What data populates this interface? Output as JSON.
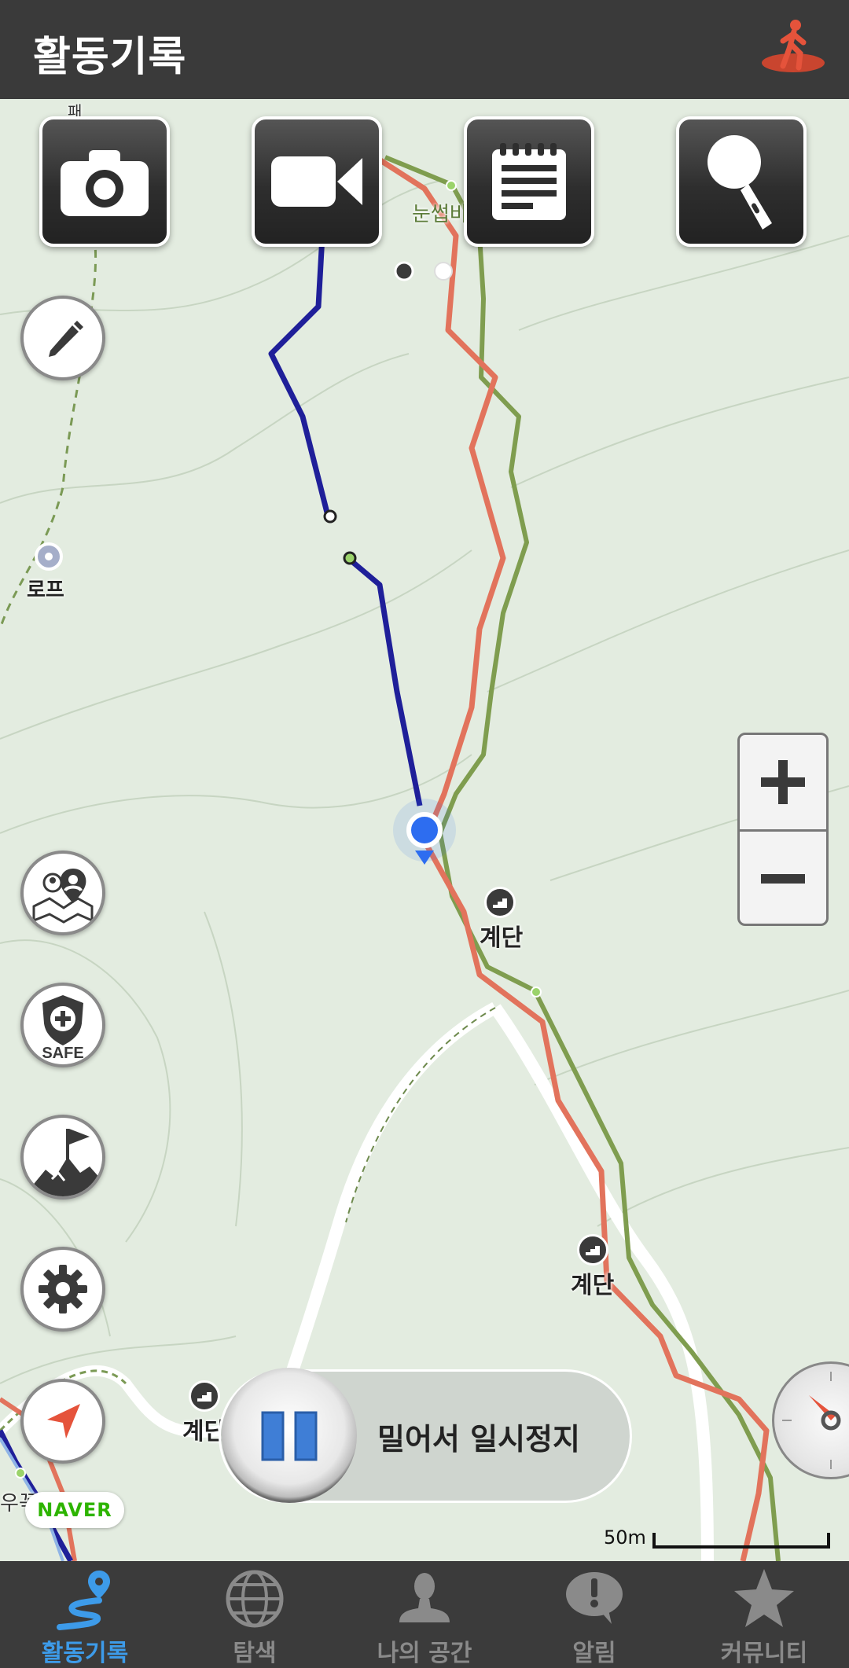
{
  "header": {
    "title": "활동기록",
    "status_icon": "walking-person-icon"
  },
  "toolbar": {
    "buttons": [
      "camera-icon",
      "video-icon",
      "note-icon",
      "microphone-icon"
    ],
    "page_indicator": {
      "pages": 2,
      "current": 1
    }
  },
  "side_buttons": [
    "pencil-icon",
    "map-people-icon",
    "safe-shield-icon",
    "summit-flag-icon",
    "gear-icon",
    "location-arrow-icon"
  ],
  "safe_label": "SAFE",
  "map": {
    "labels": {
      "rope": "로프",
      "nunseop": "눈썹바",
      "upper": "패",
      "woo": "우꼭"
    },
    "poi": [
      {
        "label": "계단"
      },
      {
        "label": "계단"
      },
      {
        "label": "계단"
      }
    ],
    "scale_label": "50m",
    "attribution": "NAVER",
    "colors": {
      "my_track": "#1f1f99",
      "route_red": "#e2735c",
      "route_green": "#7f9d4f",
      "position": "#2d6df0"
    }
  },
  "pause": {
    "label": "밀어서 일시정지"
  },
  "zoom": {
    "in": "+",
    "out": "−"
  },
  "tabs": [
    {
      "label": "활동기록",
      "icon": "route-pin-icon",
      "active": true
    },
    {
      "label": "탐색",
      "icon": "globe-icon",
      "active": false
    },
    {
      "label": "나의 공간",
      "icon": "person-icon",
      "active": false
    },
    {
      "label": "알림",
      "icon": "alert-bubble-icon",
      "active": false
    },
    {
      "label": "커뮤니티",
      "icon": "star-icon",
      "active": false
    }
  ]
}
